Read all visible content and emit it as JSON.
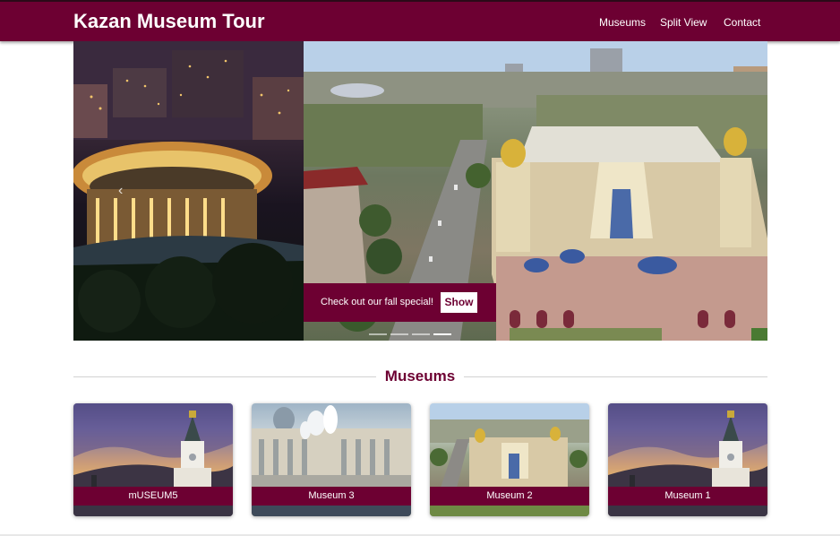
{
  "header": {
    "title": "Kazan Museum Tour",
    "nav": [
      {
        "label": "Museums"
      },
      {
        "label": "Split View"
      },
      {
        "label": "Contact"
      }
    ]
  },
  "carousel": {
    "caption": "Check out our fall special!",
    "button_label": "Show",
    "indicator_count": 4,
    "active_indicator": 4,
    "prev_glyph": "‹"
  },
  "museums_section": {
    "title": "Museums",
    "cards": [
      {
        "label": "mUSEUM5",
        "image": "kremlin-tower-sunset"
      },
      {
        "label": "Museum 3",
        "image": "palace-fountains"
      },
      {
        "label": "Museum 2",
        "image": "aerial-puppet-theater"
      },
      {
        "label": "Museum 1",
        "image": "kremlin-tower-sunset"
      }
    ]
  },
  "colors": {
    "brand": "#6d0032",
    "navbar_border": "#2b0a18"
  }
}
